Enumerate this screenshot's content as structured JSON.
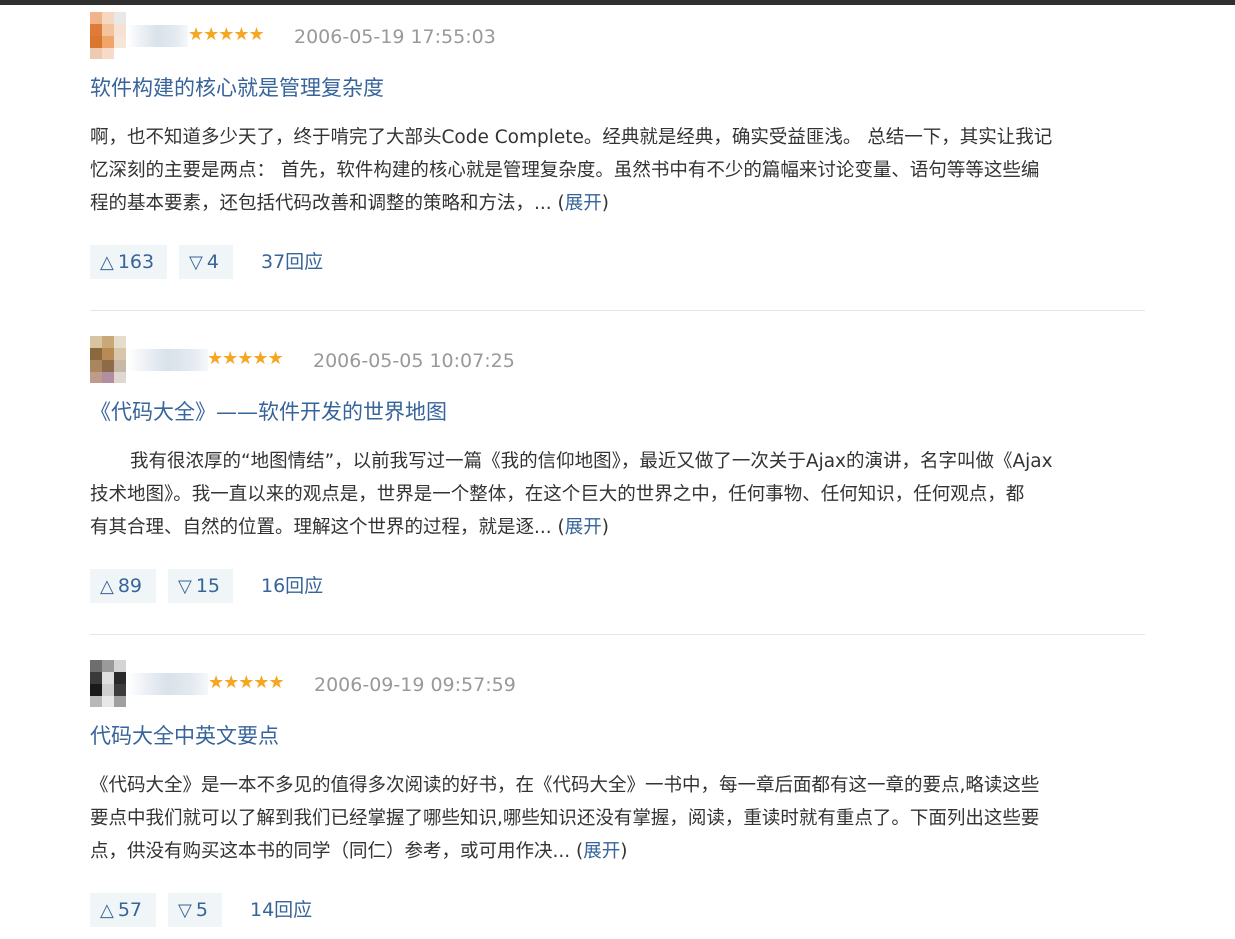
{
  "reviews": [
    {
      "stars": "★★★★★",
      "date": "2006-05-19 17:55:03",
      "title": "软件构建的核心就是管理复杂度",
      "lines": [
        "啊，也不知道多少天了，终于啃完了大部头Code Complete。经典就是经典，确实受益匪浅。 总结一下，其实让我记",
        "忆深刻的主要是两点： 首先，软件构建的核心就是管理复杂度。虽然书中有不少的篇幅来讨论变量、语句等等这些编",
        "程的基本要素，还包括代码改善和调整的策略和方法，... "
      ],
      "expand_open": "(",
      "expand_label": "展开",
      "expand_close": ")",
      "up": "163",
      "down": "4",
      "replies": "37回应"
    },
    {
      "stars": "★★★★★",
      "date": "2006-05-05 10:07:25",
      "title": "《代码大全》——软件开发的世界地图",
      "lines": [
        "我有很浓厚的“地图情结”，以前我写过一篇《我的信仰地图》，最近又做了一次关于Ajax的演讲，名字叫做《Ajax",
        "技术地图》。我一直以来的观点是，世界是一个整体，在这个巨大的世界之中，任何事物、任何知识，任何观点，都",
        "有其合理、自然的位置。理解这个世界的过程，就是逐... "
      ],
      "expand_open": "(",
      "expand_label": "展开",
      "expand_close": ")",
      "up": "89",
      "down": "15",
      "replies": "16回应"
    },
    {
      "stars": "★★★★★",
      "date": "2006-09-19 09:57:59",
      "title": "代码大全中英文要点",
      "lines": [
        "《代码大全》是一本不多见的值得多次阅读的好书，在《代码大全》一书中，每一章后面都有这一章的要点,略读这些",
        "要点中我们就可以了解到我们已经掌握了哪些知识,哪些知识还没有掌握，阅读，重读时就有重点了。下面列出这些要",
        "点，供没有购买这本书的同学（同仁）参考，或可用作决... "
      ],
      "expand_open": "(",
      "expand_label": "展开",
      "expand_close": ")",
      "up": "57",
      "down": "5",
      "replies": "14回应"
    }
  ],
  "icons": {
    "upvote": "triangle-up-icon",
    "downvote": "triangle-down-icon",
    "star": "star-icon"
  },
  "colors": {
    "link": "#37649a",
    "star": "#f5a623",
    "date": "#999999",
    "vote_bg": "#f0f5f7"
  }
}
